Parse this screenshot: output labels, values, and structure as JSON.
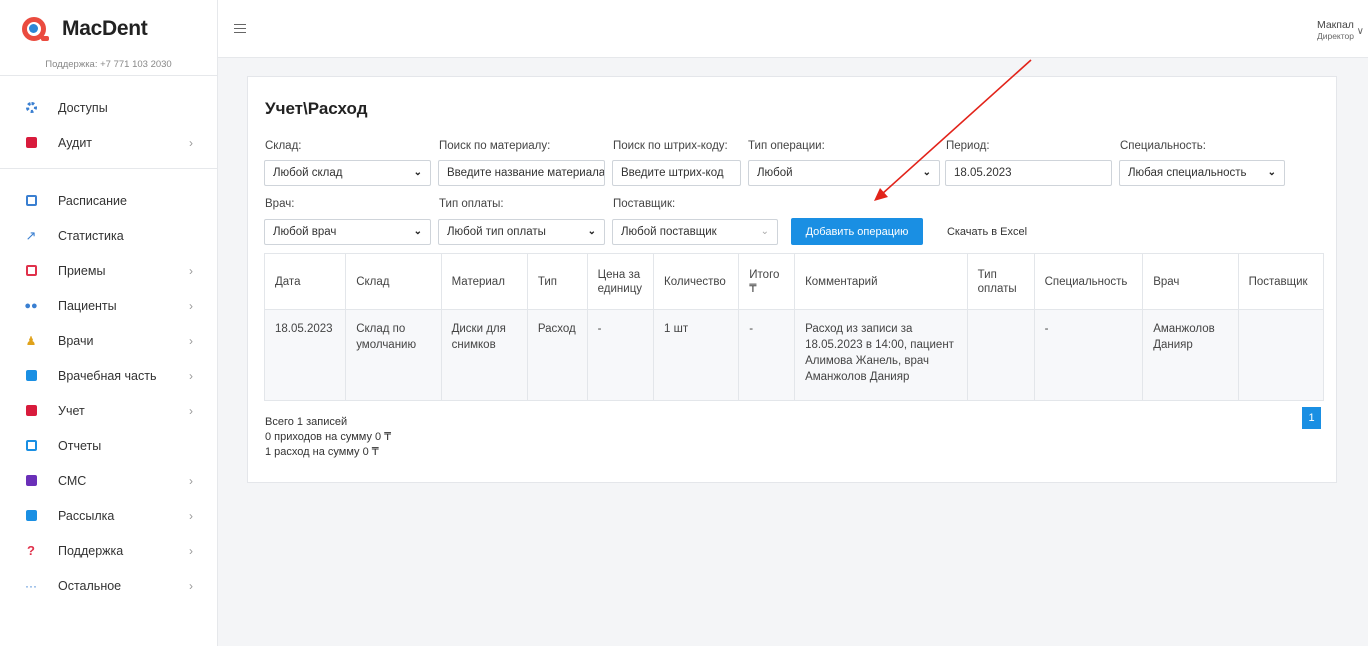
{
  "brand": {
    "name": "MacDent",
    "support": "Поддержка: +7 771 103 2030"
  },
  "user": {
    "name": "Макпал",
    "role": "Директор"
  },
  "sidebar": {
    "group1": [
      {
        "label": "Доступы",
        "icon": "gear-icon",
        "color": "#3a7fd1",
        "chevron": ""
      },
      {
        "label": "Аудит",
        "icon": "book-icon",
        "color": "#d81b3c",
        "chevron": "›"
      }
    ],
    "group2": [
      {
        "label": "Расписание",
        "icon": "calendar-icon",
        "color": "#3a7fd1",
        "chevron": ""
      },
      {
        "label": "Статистика",
        "icon": "chart-icon",
        "color": "#3a7fd1",
        "chevron": ""
      },
      {
        "label": "Приемы",
        "icon": "calendar-icon",
        "color": "#e0314b",
        "chevron": "›"
      },
      {
        "label": "Пациенты",
        "icon": "people-icon",
        "color": "#3a7fd1",
        "chevron": "›"
      },
      {
        "label": "Врачи",
        "icon": "doctor-icon",
        "color": "#e0a21b",
        "chevron": "›"
      },
      {
        "label": "Врачебная часть",
        "icon": "medkit-icon",
        "color": "#1a8fe3",
        "chevron": "›"
      },
      {
        "label": "Учет",
        "icon": "book-icon",
        "color": "#d81b3c",
        "chevron": "›"
      },
      {
        "label": "Отчеты",
        "icon": "calendar-icon",
        "color": "#1a8fe3",
        "chevron": ""
      },
      {
        "label": "СМС",
        "icon": "message-icon",
        "color": "#6a2fb8",
        "chevron": "›"
      },
      {
        "label": "Рассылка",
        "icon": "chat-icon",
        "color": "#1a8fe3",
        "chevron": "›"
      },
      {
        "label": "Поддержка",
        "icon": "question-icon",
        "color": "#e0314b",
        "chevron": "›"
      },
      {
        "label": "Остальное",
        "icon": "more-icon",
        "color": "#3a7fd1",
        "chevron": "›"
      }
    ]
  },
  "page": {
    "title": "Учет\\Расход"
  },
  "filters": {
    "warehouse": {
      "label": "Склад:",
      "value": "Любой склад"
    },
    "material": {
      "label": "Поиск по материалу:",
      "placeholder": "Введите название материала"
    },
    "barcode": {
      "label": "Поиск по штрих-коду:",
      "placeholder": "Введите штрих-код"
    },
    "op_type": {
      "label": "Тип операции:",
      "value": "Любой"
    },
    "period": {
      "label": "Период:",
      "value": "18.05.2023"
    },
    "specialty": {
      "label": "Специальность:",
      "value": "Любая специальность"
    },
    "doctor": {
      "label": "Врач:",
      "value": "Любой врач"
    },
    "pay_type": {
      "label": "Тип оплаты:",
      "value": "Любой тип оплаты"
    },
    "supplier": {
      "label": "Поставщик:",
      "value": "Любой поставщик"
    }
  },
  "actions": {
    "add": "Добавить операцию",
    "excel": "Скачать в Excel"
  },
  "table": {
    "headers": [
      "Дата",
      "Склад",
      "Материал",
      "Тип",
      "Цена за единицу",
      "Количество",
      "Итого ₸",
      "Комментарий",
      "Тип оплаты",
      "Специальность",
      "Врач",
      "Поставщик"
    ],
    "rows": [
      [
        "18.05.2023",
        "Склад по умолчанию",
        "Диски для снимков",
        "Расход",
        "-",
        "1 шт",
        "-",
        "Расход из записи за 18.05.2023 в 14:00, пациент Алимова Жанель, врач Аманжолов Данияр",
        "",
        "-",
        "Аманжолов Данияр",
        ""
      ]
    ]
  },
  "summary": {
    "total": "Всего 1 записей",
    "income": "0 приходов на сумму 0 ₸",
    "expense": "1 расход на сумму 0 ₸"
  },
  "pagination": {
    "current": "1"
  },
  "colors": {
    "accent": "#1a8fe3",
    "annotation_arrow": "#e2231a"
  }
}
